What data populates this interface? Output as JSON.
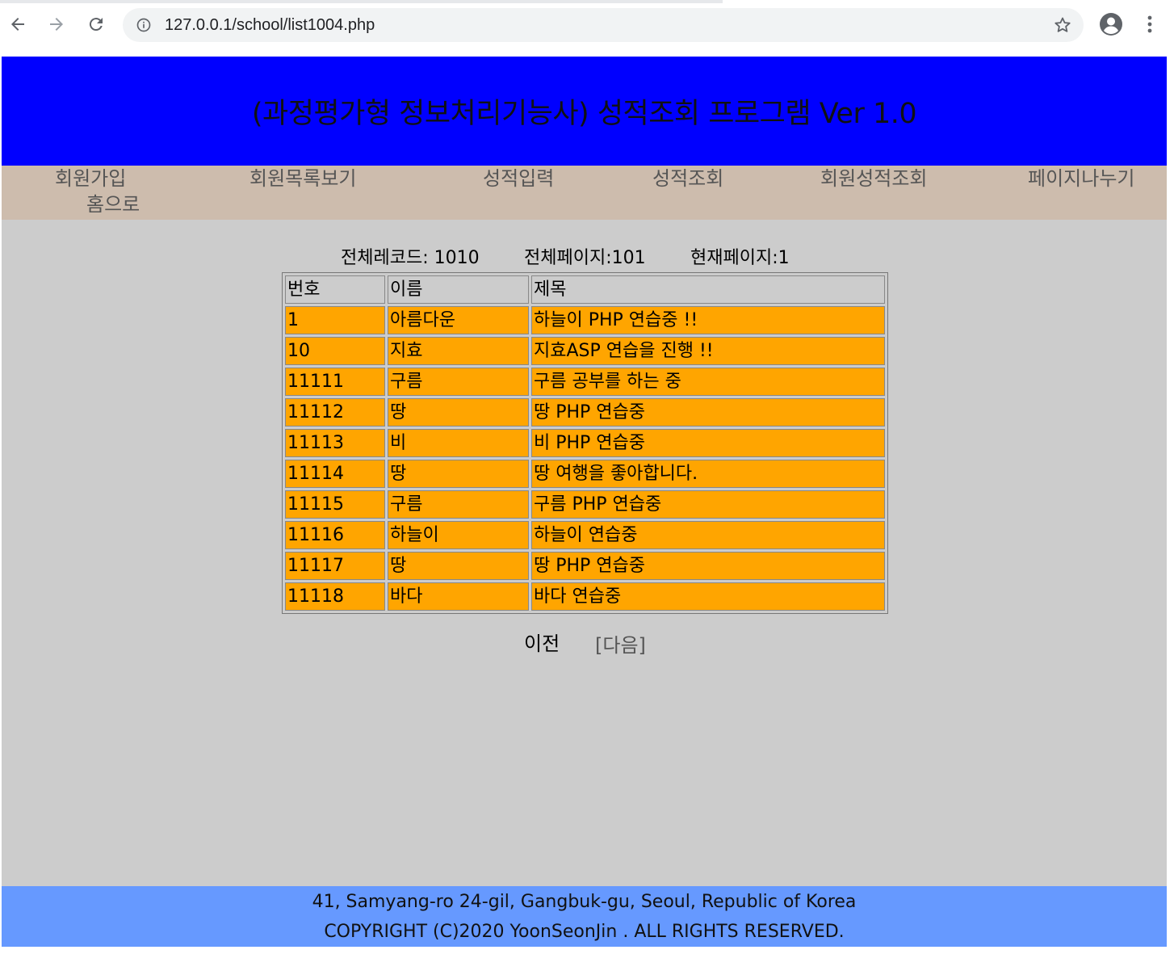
{
  "browser": {
    "url": "127.0.0.1/school/list1004.php"
  },
  "header": {
    "title": "(과정평가형 정보처리기능사) 성적조회 프로그램 Ver 1.0"
  },
  "nav": {
    "items": [
      "회원가입",
      "회원목록보기",
      "성적입력",
      "성적조회",
      "회원성적조회",
      "페이지나누기",
      "홈으로"
    ]
  },
  "stats": {
    "total_records": "전체레코드: 1010",
    "total_pages": "전체페이지:101",
    "current_page": "현재페이지:1"
  },
  "table": {
    "headers": [
      "번호",
      "이름",
      "제목"
    ],
    "rows": [
      [
        "1",
        "아름다운",
        "하늘이 PHP 연습중 !!"
      ],
      [
        "10",
        "지효",
        "지효ASP 연습을 진행 !!"
      ],
      [
        "11111",
        "구름",
        "구름 공부를 하는 중"
      ],
      [
        "11112",
        "땅",
        "땅 PHP 연습중"
      ],
      [
        "11113",
        "비",
        "비 PHP 연습중"
      ],
      [
        "11114",
        "땅",
        "땅 여행을 좋아합니다."
      ],
      [
        "11115",
        "구름",
        "구름 PHP 연습중"
      ],
      [
        "11116",
        "하늘이",
        "하늘이 연습중"
      ],
      [
        "11117",
        "땅",
        "땅 PHP 연습중"
      ],
      [
        "11118",
        "바다",
        "바다 연습중"
      ]
    ]
  },
  "pager": {
    "prev": "이전",
    "next": "[다음]"
  },
  "footer": {
    "address": "41, Samyang-ro 24-gil, Gangbuk-gu, Seoul, Republic of Korea",
    "copyright": "COPYRIGHT (C)2020 YoonSeonJin . ALL RIGHTS RESERVED."
  },
  "colors": {
    "header_bg": "#0000ff",
    "nav_bg": "#cdbcad",
    "content_bg": "#cccccc",
    "row_bg": "#ffa500",
    "footer_bg": "#6699ff"
  },
  "icons": [
    "back-arrow-icon",
    "forward-arrow-icon",
    "reload-icon",
    "info-icon",
    "star-icon",
    "account-icon",
    "more-vert-icon"
  ]
}
